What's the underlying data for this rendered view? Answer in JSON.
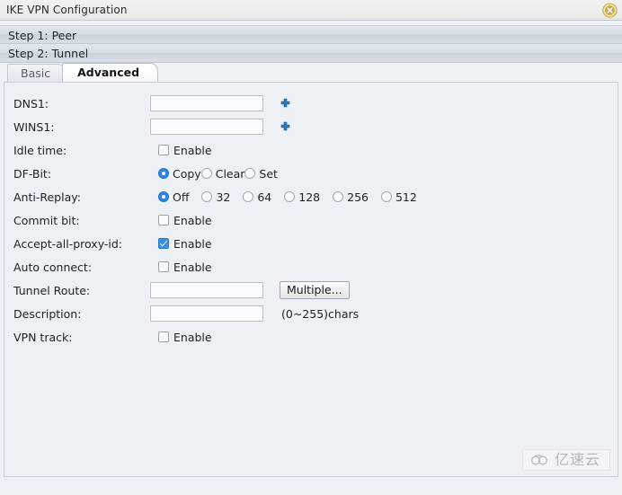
{
  "window": {
    "title": "IKE VPN Configuration",
    "close_icon": "close-circle-icon"
  },
  "steps": [
    {
      "label": "Step 1: Peer"
    },
    {
      "label": "Step 2: Tunnel"
    }
  ],
  "tabs": [
    {
      "label": "Basic",
      "active": false
    },
    {
      "label": "Advanced",
      "active": true
    }
  ],
  "form": {
    "dns1": {
      "label": "DNS1:",
      "value": "",
      "placeholder": "",
      "add_icon": "plus-icon"
    },
    "wins1": {
      "label": "WINS1:",
      "value": "",
      "placeholder": "",
      "add_icon": "plus-icon"
    },
    "idle_time": {
      "label": "Idle time:",
      "enable_label": "Enable",
      "checked": false
    },
    "df_bit": {
      "label": "DF-Bit:",
      "options": [
        "Copy",
        "Clear",
        "Set"
      ],
      "selected": "Copy"
    },
    "anti_replay": {
      "label": "Anti-Replay:",
      "options": [
        "Off",
        "32",
        "64",
        "128",
        "256",
        "512"
      ],
      "selected": "Off"
    },
    "commit_bit": {
      "label": "Commit bit:",
      "enable_label": "Enable",
      "checked": false
    },
    "accept_all_proxy_id": {
      "label": "Accept-all-proxy-id:",
      "enable_label": "Enable",
      "checked": true
    },
    "auto_connect": {
      "label": "Auto connect:",
      "enable_label": "Enable",
      "checked": false
    },
    "tunnel_route": {
      "label": "Tunnel Route:",
      "value": "",
      "button_label": "Multiple..."
    },
    "description": {
      "label": "Description:",
      "value": "",
      "hint": "(0~255)chars"
    },
    "vpn_track": {
      "label": "VPN track:",
      "enable_label": "Enable",
      "checked": false
    }
  },
  "watermark": {
    "text": "亿速云",
    "icon": "cloud-icon"
  }
}
